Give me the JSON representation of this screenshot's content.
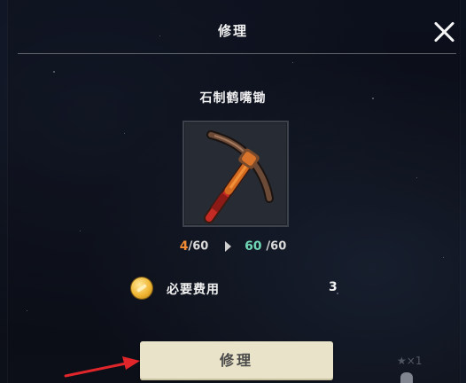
{
  "header": {
    "title": "修理"
  },
  "item": {
    "name": "石制鹤嘴锄"
  },
  "durability": {
    "current": "4",
    "max_current": "/60",
    "after": "60",
    "max_after": "/60"
  },
  "cost": {
    "label": "必要费用",
    "value": "3"
  },
  "button": {
    "repair_label": "修理"
  },
  "background": {
    "faint_text": "★×1"
  },
  "colors": {
    "durability_current": "#f08a35",
    "durability_after": "#6fd6b4",
    "button_bg": "#e9e4c9",
    "annotation_arrow": "#e0262b"
  },
  "icons": {
    "close": "close-icon",
    "coin": "coin-icon",
    "item": "pickaxe-icon",
    "arrow": "chevron-right-icon"
  }
}
